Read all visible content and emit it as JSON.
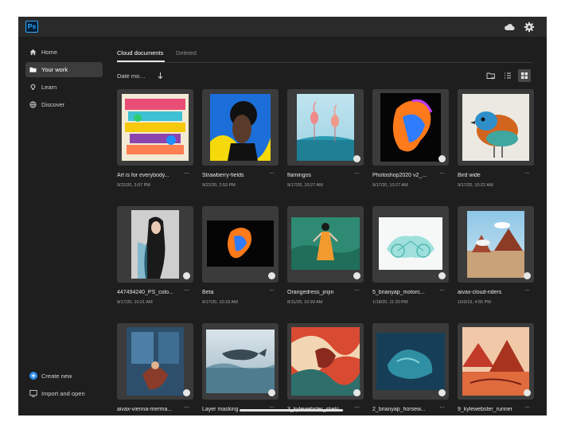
{
  "app": {
    "logo_text": "Ps"
  },
  "topbar": {
    "icons": [
      "cloud-icon",
      "gear-icon"
    ]
  },
  "sidebar": {
    "items": [
      {
        "label": "Home",
        "icon": "home-icon",
        "active": false
      },
      {
        "label": "Your work",
        "icon": "folder-icon",
        "active": true
      },
      {
        "label": "Learn",
        "icon": "lightbulb-icon",
        "active": false
      },
      {
        "label": "Discover",
        "icon": "globe-icon",
        "active": false
      }
    ],
    "bottom": [
      {
        "label": "Create new",
        "icon": "plus-circle-icon"
      },
      {
        "label": "Import and open",
        "icon": "import-icon"
      }
    ]
  },
  "tabs": [
    {
      "label": "Cloud documents",
      "active": true
    },
    {
      "label": "Deleted",
      "active": false
    }
  ],
  "sort": {
    "label": "Date mo…"
  },
  "view": {
    "selected": "grid"
  },
  "more_label": "···",
  "documents": [
    {
      "name": "Art is for everybody...",
      "date": "9/22/20, 3:07 PM"
    },
    {
      "name": "Strawberry-fields",
      "date": "9/22/20, 2:53 PM"
    },
    {
      "name": "flamingos",
      "date": "9/17/20, 10:27 AM"
    },
    {
      "name": "Photoshop2020 v2_...",
      "date": "9/17/20, 10:27 AM"
    },
    {
      "name": "Bird wide",
      "date": "9/17/20, 10:22 AM"
    },
    {
      "name": "447494240_PS_colo...",
      "date": "9/17/20, 10:21 AM"
    },
    {
      "name": "Beta",
      "date": "9/17/20, 10:18 AM"
    },
    {
      "name": "Orangedress_jinjin",
      "date": "8/11/20, 10:39 AM"
    },
    {
      "name": "5_brianyap_motorc...",
      "date": "1/18/20, 11:20 PM"
    },
    {
      "name": "aivax-cloud-riders",
      "date": "10/3/19, 4:55 PM"
    },
    {
      "name": "aivax-vienna-merma...",
      "date": ""
    },
    {
      "name": "Layer masking",
      "date": ""
    },
    {
      "name": "3_kylewebster_sketc...",
      "date": ""
    },
    {
      "name": "2_brianyap_horsew...",
      "date": ""
    },
    {
      "name": "9_kylewebster_runner",
      "date": ""
    }
  ],
  "colors": {
    "background": "#1e1e1e",
    "topbar": "#2a2a2a",
    "accent": "#31a8ff",
    "active_item": "#3c3c3c"
  }
}
